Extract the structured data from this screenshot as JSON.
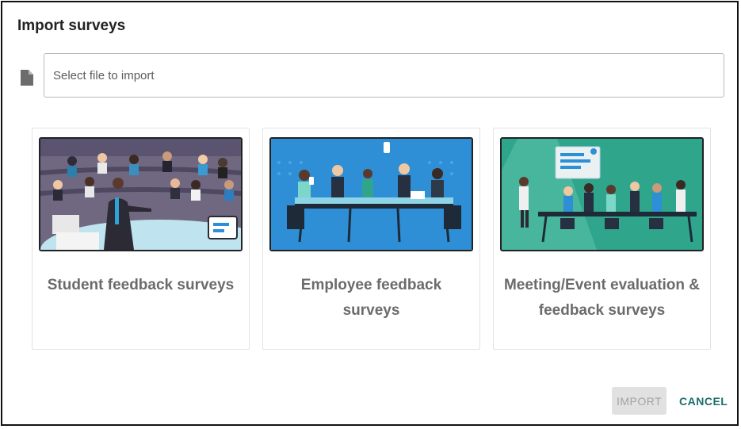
{
  "dialog": {
    "title": "Import surveys",
    "file_input": {
      "placeholder": "Select file to import",
      "value": ""
    },
    "cards": [
      {
        "label": "Student feedback surveys",
        "illustration": "lecture-hall-illustration"
      },
      {
        "label": "Employee feedback surveys",
        "illustration": "boardroom-meeting-illustration"
      },
      {
        "label": "Meeting/Event evaluation & feedback surveys",
        "illustration": "conference-presentation-illustration"
      }
    ],
    "buttons": {
      "import": "IMPORT",
      "cancel": "CANCEL"
    }
  },
  "colors": {
    "card_label": "#6b6b6b",
    "cancel_text": "#1b6e6b",
    "import_disabled_bg": "#e1e1e1",
    "import_disabled_text": "#a3a3a3",
    "illus_lecture_bg": "#6f6880",
    "illus_boardroom_bg": "#2e8fd6",
    "illus_conference_bg": "#2fa58c"
  }
}
